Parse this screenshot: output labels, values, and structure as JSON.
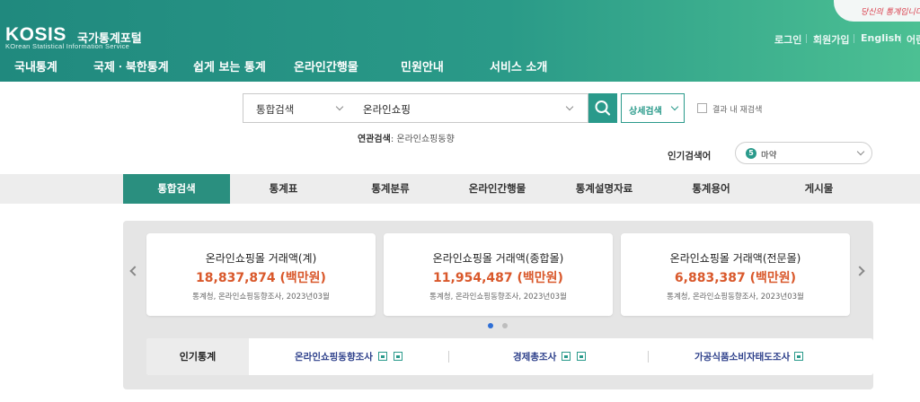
{
  "header": {
    "logo": "KOSIS",
    "logo_kr": "국가통계포털",
    "logo_sub": "KOrean Statistical Information Service",
    "slogan": "당신의 통계입니다",
    "util": [
      "로그인",
      "회원가입",
      "English",
      "어린"
    ],
    "nav": [
      "국내통계",
      "국제ㆍ북한통계",
      "쉽게 보는 통계",
      "온라인간행물",
      "민원안내",
      "서비스 소개"
    ]
  },
  "search": {
    "scope": "통합검색",
    "query": "온라인쇼핑",
    "advanced": "상세검색",
    "within_results": "결과 내 재검색",
    "related_label": "연관검색",
    "related_value": "온라인쇼핑동향",
    "popular_label": "인기검색어",
    "popular_rank": "5",
    "popular_term": "마약"
  },
  "tabs": [
    "통합검색",
    "통계표",
    "통계분류",
    "온라인간행물",
    "통계설명자료",
    "통계용어",
    "게시물"
  ],
  "cards": [
    {
      "title": "온라인쇼핑몰 거래액(계)",
      "value": "18,837,874 (백만원)",
      "source": "통계청, 온라인쇼핑동향조사, 2023년03월"
    },
    {
      "title": "온라인쇼핑몰 거래액(종합몰)",
      "value": "11,954,487 (백만원)",
      "source": "통계청, 온라인쇼핑동향조사, 2023년03월"
    },
    {
      "title": "온라인쇼핑몰 거래액(전문몰)",
      "value": "6,883,387 (백만원)",
      "source": "통계청, 온라인쇼핑동향조사, 2023년03월"
    }
  ],
  "popular_stats": {
    "label": "인기통계",
    "links": [
      "온라인쇼핑동향조사",
      "경제총조사",
      "가공식품소비자태도조사"
    ]
  },
  "colors": {
    "header": "#20897e",
    "accent": "#2a9a8b",
    "value": "#d9582b",
    "link": "#2c3f8a"
  }
}
